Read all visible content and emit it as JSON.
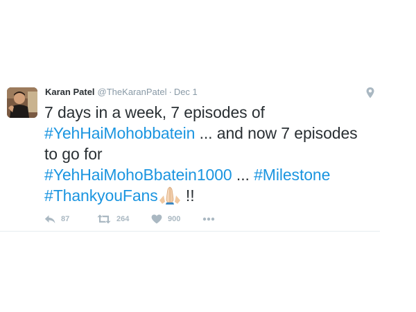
{
  "tweet": {
    "display_name": "Karan Patel",
    "handle": "@TheKaranPatel",
    "separator": "·",
    "date": "Dec 1",
    "text": {
      "part1": "7 days in a week, 7 episodes of",
      "hashtag1": "#YehHaiMohobbatein",
      "part2": " ... and now 7 episodes to go for",
      "hashtag2": "#YehHaiMohoBbatein1000",
      "part3": " ... ",
      "hashtag3": "#Milestone",
      "hashtag4": "#ThankyouFans",
      "part4": " !!"
    },
    "emoji": "folded-hands",
    "actions": {
      "reply_count": "87",
      "retweet_count": "264",
      "like_count": "900"
    }
  },
  "icons": {
    "location": "location-pin-icon",
    "reply": "reply-icon",
    "retweet": "retweet-icon",
    "like": "heart-icon",
    "more": "more-icon"
  },
  "colors": {
    "hashtag": "#1b95e0",
    "text": "#292f33",
    "meta": "#8899a6",
    "action": "#aab8c2"
  }
}
